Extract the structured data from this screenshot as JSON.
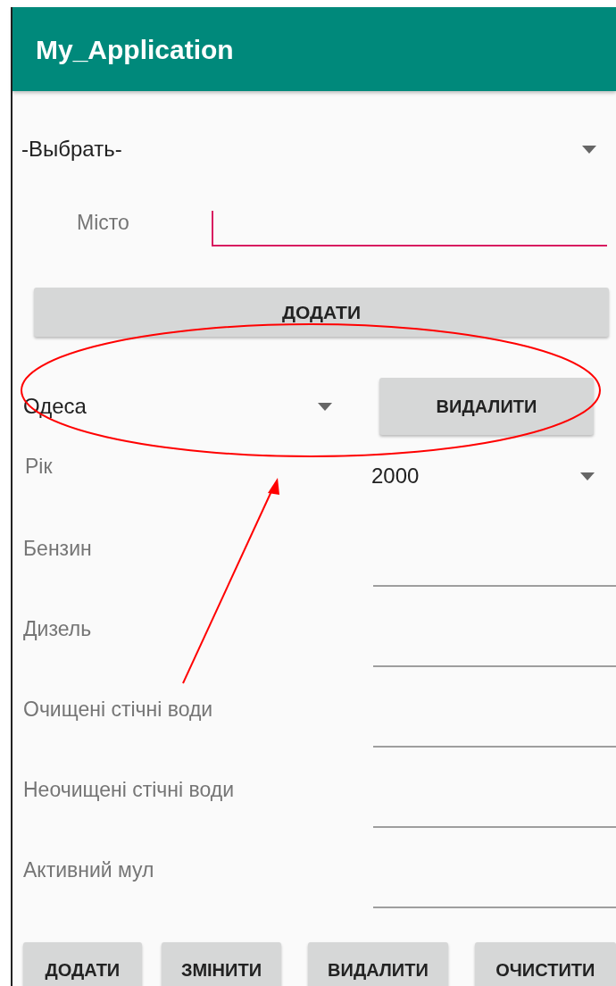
{
  "app_bar": {
    "title": "My_Application"
  },
  "city_spinner": {
    "value": "-Выбрать-"
  },
  "city_field": {
    "label": "Місто",
    "focused": true
  },
  "add_city_button": "ДОДАТИ",
  "selected_city": {
    "value": "Одеса"
  },
  "delete_city_button": "ВИДАЛИТИ",
  "year": {
    "label": "Рік",
    "value": "2000"
  },
  "fields": [
    {
      "label": "Бензин"
    },
    {
      "label": "Дизель"
    },
    {
      "label": "Очищені стічні води"
    },
    {
      "label": "Неочищені стічні води"
    },
    {
      "label": "Активний мул"
    }
  ],
  "buttons": [
    "ДОДАТИ",
    "ЗМІНИТИ",
    "ВИДАЛИТИ",
    "ОЧИСТИТИ"
  ]
}
